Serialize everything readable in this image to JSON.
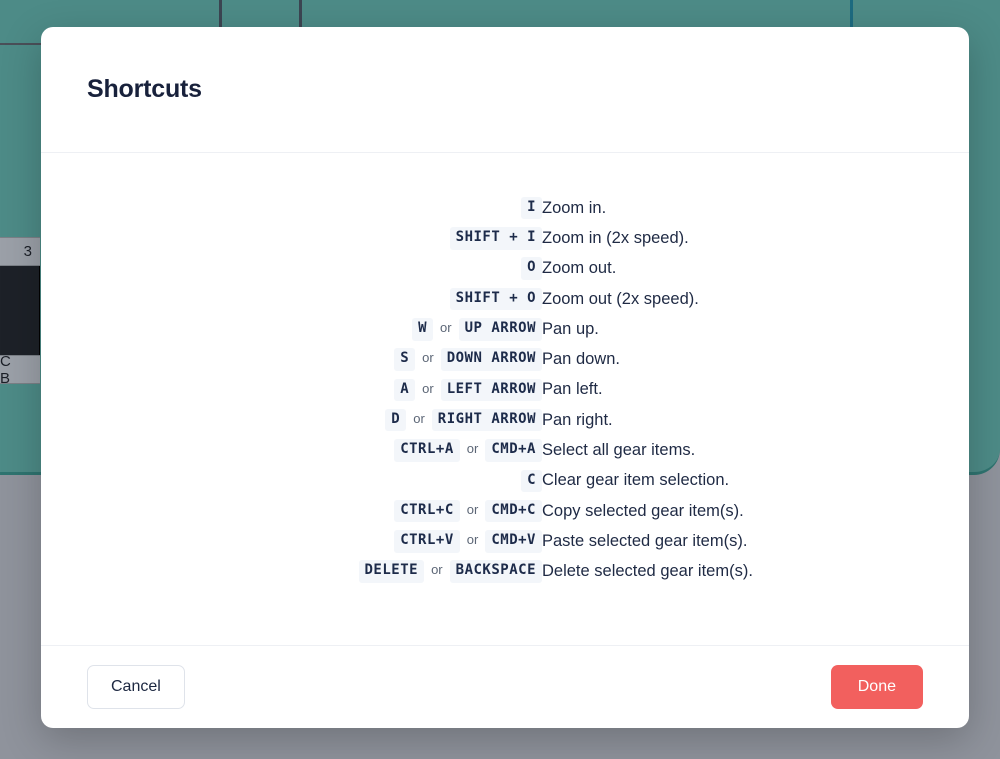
{
  "background": {
    "teal_color": "#4d8b87",
    "overlay_color": "#8f939c",
    "panel_labels": [
      "3",
      "C B"
    ]
  },
  "modal": {
    "title": "Shortcuts",
    "shortcuts": [
      {
        "keys": [
          "I"
        ],
        "description": "Zoom in."
      },
      {
        "keys": [
          "SHIFT + I"
        ],
        "description": "Zoom in (2x speed)."
      },
      {
        "keys": [
          "O"
        ],
        "description": "Zoom out."
      },
      {
        "keys": [
          "SHIFT + O"
        ],
        "description": "Zoom out (2x speed)."
      },
      {
        "keys": [
          "W",
          "UP ARROW"
        ],
        "separator": "or",
        "description": "Pan up."
      },
      {
        "keys": [
          "S",
          "DOWN ARROW"
        ],
        "separator": "or",
        "description": "Pan down."
      },
      {
        "keys": [
          "A",
          "LEFT ARROW"
        ],
        "separator": "or",
        "description": "Pan left."
      },
      {
        "keys": [
          "D",
          "RIGHT ARROW"
        ],
        "separator": "or",
        "description": "Pan right."
      },
      {
        "keys": [
          "CTRL+A",
          "CMD+A"
        ],
        "separator": "or",
        "description": "Select all gear items."
      },
      {
        "keys": [
          "C"
        ],
        "description": "Clear gear item selection."
      },
      {
        "keys": [
          "CTRL+C",
          "CMD+C"
        ],
        "separator": "or",
        "description": "Copy selected gear item(s)."
      },
      {
        "keys": [
          "CTRL+V",
          "CMD+V"
        ],
        "separator": "or",
        "description": "Paste selected gear item(s)."
      },
      {
        "keys": [
          "DELETE",
          "BACKSPACE"
        ],
        "separator": "or",
        "description": "Delete selected gear item(s)."
      }
    ],
    "footer": {
      "cancel_label": "Cancel",
      "done_label": "Done",
      "done_color": "#f2605e"
    }
  }
}
